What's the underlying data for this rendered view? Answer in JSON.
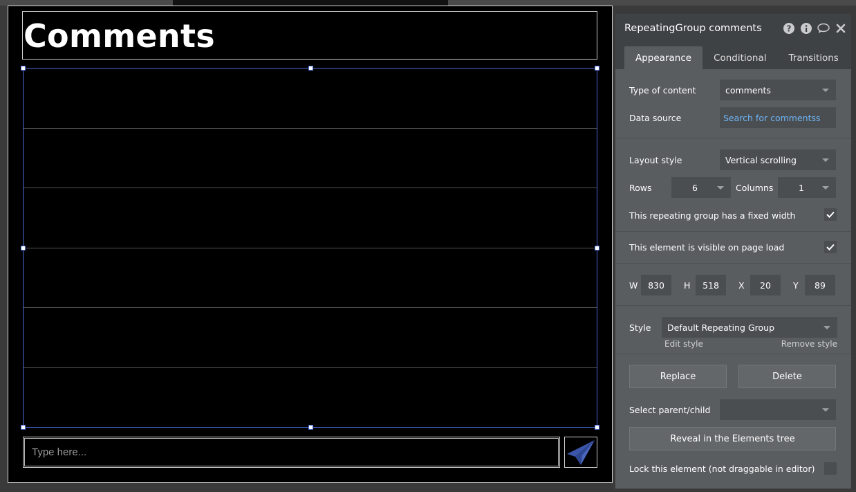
{
  "canvas": {
    "title": "Comments",
    "input_placeholder": "Type here...",
    "send_icon": "paper-plane-icon"
  },
  "panel": {
    "title": "RepeatingGroup comments",
    "header_icons": [
      "help-icon",
      "info-icon",
      "comment-icon",
      "close-icon"
    ],
    "tabs": [
      "Appearance",
      "Conditional",
      "Transitions"
    ],
    "active_tab": "Appearance",
    "type_of_content": {
      "label": "Type of content",
      "value": "comments"
    },
    "data_source": {
      "label": "Data source",
      "value": "Search for commentss"
    },
    "layout_style": {
      "label": "Layout style",
      "value": "Vertical scrolling"
    },
    "rows": {
      "label": "Rows",
      "value": "6"
    },
    "columns": {
      "label": "Columns",
      "value": "1"
    },
    "fixed_width": {
      "label": "This repeating group has a fixed width",
      "checked": true
    },
    "visible_on_load": {
      "label": "This element is visible on page load",
      "checked": true
    },
    "dimensions": {
      "w_label": "W",
      "w": "830",
      "h_label": "H",
      "h": "518",
      "x_label": "X",
      "x": "20",
      "y_label": "Y",
      "y": "89"
    },
    "style": {
      "label": "Style",
      "value": "Default Repeating Group",
      "edit": "Edit style",
      "remove": "Remove style"
    },
    "replace_label": "Replace",
    "delete_label": "Delete",
    "select_parent_child": {
      "label": "Select parent/child",
      "value": ""
    },
    "reveal_label": "Reveal in the Elements tree",
    "lock": {
      "label": "Lock this element (not draggable in editor)",
      "checked": false
    }
  },
  "colors": {
    "selection": "#4a6bd6",
    "panel_bg": "#5a5d60",
    "header_bg": "#3f4245",
    "link": "#6cb4f5",
    "send_icon": "#3b55a8"
  }
}
